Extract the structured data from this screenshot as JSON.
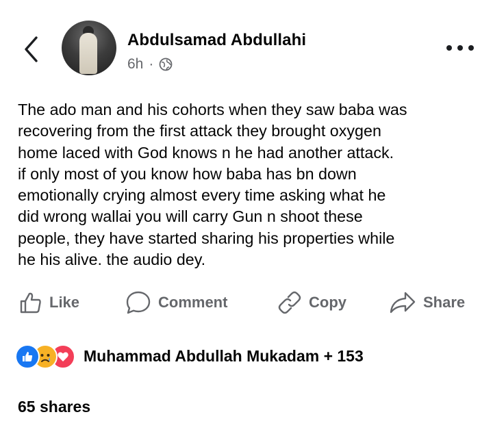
{
  "header": {
    "author_name": "Abdulsamad Abdullahi",
    "time": "6h",
    "separator": "·",
    "privacy_icon": "globe-icon"
  },
  "post": {
    "lines": [
      "The ado man and his cohorts when they saw baba was",
      "recovering from the first attack they brought oxygen",
      "home laced with God knows n he had another attack.",
      "if only most of you know how baba has bn down",
      "emotionally crying almost every time asking what he",
      "did wrong wallai you will carry Gun n shoot these",
      "people, they have started sharing his properties while",
      "he his alive. the audio dey."
    ]
  },
  "actions": {
    "like": "Like",
    "comment": "Comment",
    "copy": "Copy",
    "share": "Share"
  },
  "reactions": {
    "names": "Muhammad Abdullah Mukadam + 153",
    "icons": [
      "like-reaction-icon",
      "sad-reaction-icon",
      "love-reaction-icon"
    ]
  },
  "shares": "65 shares",
  "colors": {
    "text": "#050505",
    "secondary": "#65676b",
    "like_blue": "#1877f2",
    "sad_yellow": "#f7b125",
    "love_red": "#f33e58"
  }
}
